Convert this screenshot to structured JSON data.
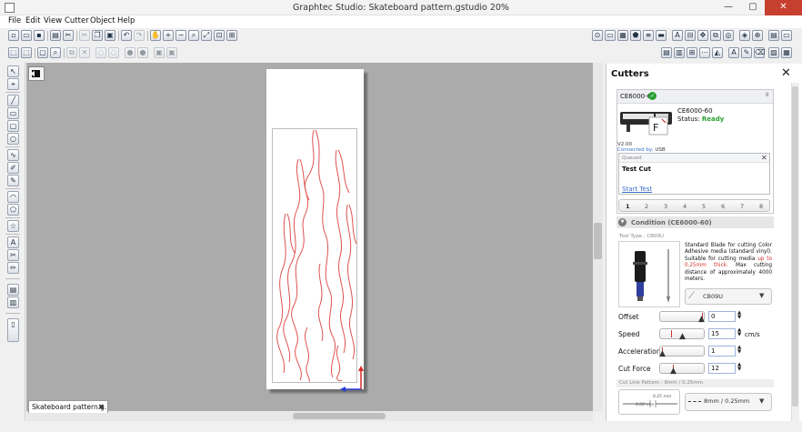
{
  "window": {
    "title": "Graphtec Studio: Skateboard pattern.gstudio 20%",
    "minimize": "—",
    "maximize": "▢",
    "close": "✕"
  },
  "menu": [
    "File",
    "Edit",
    "View",
    "Cutter",
    "Object",
    "Help"
  ],
  "document": {
    "tab_label": "Skateboard pattern.g...",
    "tab_close": "✖"
  },
  "colors": {
    "accent": "#3a6ec9",
    "flame_stroke": "#e05252",
    "ready": "#2aa032",
    "canvas_bg": "#ababab"
  },
  "cutters_panel": {
    "title": "Cutters",
    "close": "✕",
    "device": {
      "name": "CE6000-60",
      "model": "CE6000-60",
      "status_label": "Status:",
      "status_value": "Ready",
      "version": "V2.00",
      "connected_label": "Connected by:",
      "connected_value": "USB",
      "check_glyph": "✓",
      "pause_glyph": "II"
    },
    "queue": {
      "label": "Queued",
      "job": "Test Cut",
      "action": "Start Test",
      "close": "✕"
    },
    "slots": [
      "1",
      "2",
      "3",
      "4",
      "5",
      "6",
      "7",
      "8"
    ],
    "condition": {
      "title": "Condition (CE6000-60)",
      "arrow": "▼",
      "tool_type_label": "Tool Type : CB09U",
      "description_a": "Standard Blade for cutting Color Adhesive media (standard vinyl). Suitable for cutting media ",
      "description_highlight": "up to 0.25mm thick.",
      "description_b": " Max cutting distance of approximately 4000 meters.",
      "blade_select": "CB09U",
      "params": [
        {
          "label": "Offset",
          "value": "0",
          "unit": "",
          "level": 0.95
        },
        {
          "label": "Speed",
          "value": "15",
          "unit": "cm/s",
          "level": 0.25
        },
        {
          "label": "Acceleration",
          "value": "1",
          "unit": "",
          "level": 0.05
        },
        {
          "label": "Cut Force",
          "value": "12",
          "unit": "",
          "level": 0.3
        }
      ]
    },
    "cut_line": {
      "title": "Cut Line Pattern : 8mm / 0.25mm",
      "dim_a": "0.25 mm",
      "dim_b": "8.00 mm",
      "select": "8mm / 0.25mm"
    }
  }
}
